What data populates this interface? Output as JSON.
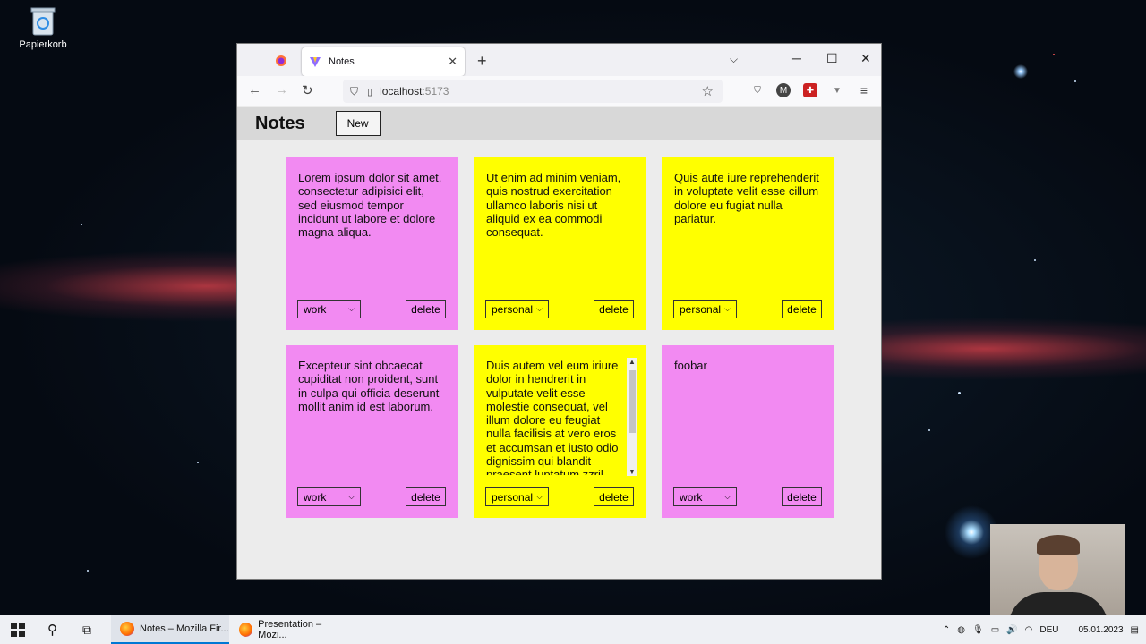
{
  "desktop": {
    "icon_label": "Papierkorb"
  },
  "browser": {
    "tab_title": "Notes",
    "url_host": "localhost",
    "url_port": ":5173",
    "accent": "#0078d4"
  },
  "app": {
    "title": "Notes",
    "new_button": "New",
    "colors": {
      "pink": "#f28af2",
      "yellow": "#ffff00"
    },
    "notes": [
      {
        "text": "Lorem ipsum dolor sit amet, consectetur adipisici elit, sed eiusmod tempor incidunt ut labore et dolore magna aliqua.",
        "category": "work",
        "color": "pink",
        "delete_label": "delete"
      },
      {
        "text": "Ut enim ad minim veniam, quis nostrud exercitation ullamco laboris nisi ut aliquid ex ea commodi consequat.",
        "category": "personal",
        "color": "yellow",
        "delete_label": "delete"
      },
      {
        "text": "Quis aute iure reprehenderit in voluptate velit esse cillum dolore eu fugiat nulla pariatur.",
        "category": "personal",
        "color": "yellow",
        "delete_label": "delete"
      },
      {
        "text": "Excepteur sint obcaecat cupiditat non proident, sunt in culpa qui officia deserunt mollit anim id est laborum.",
        "category": "work",
        "color": "pink",
        "delete_label": "delete"
      },
      {
        "text": "Duis autem vel eum iriure dolor in hendrerit in vulputate velit esse molestie consequat, vel illum dolore eu feugiat nulla facilisis at vero eros et accumsan et iusto odio dignissim qui blandit praesent luptatum zzril",
        "category": "personal",
        "color": "yellow",
        "delete_label": "delete"
      },
      {
        "text": "foobar",
        "category": "work",
        "color": "pink",
        "delete_label": "delete"
      }
    ]
  },
  "taskbar": {
    "apps": [
      {
        "label": "Notes – Mozilla Fir..."
      },
      {
        "label": "Presentation – Mozi..."
      }
    ],
    "language": "DEU",
    "date": "05.01.2023"
  }
}
